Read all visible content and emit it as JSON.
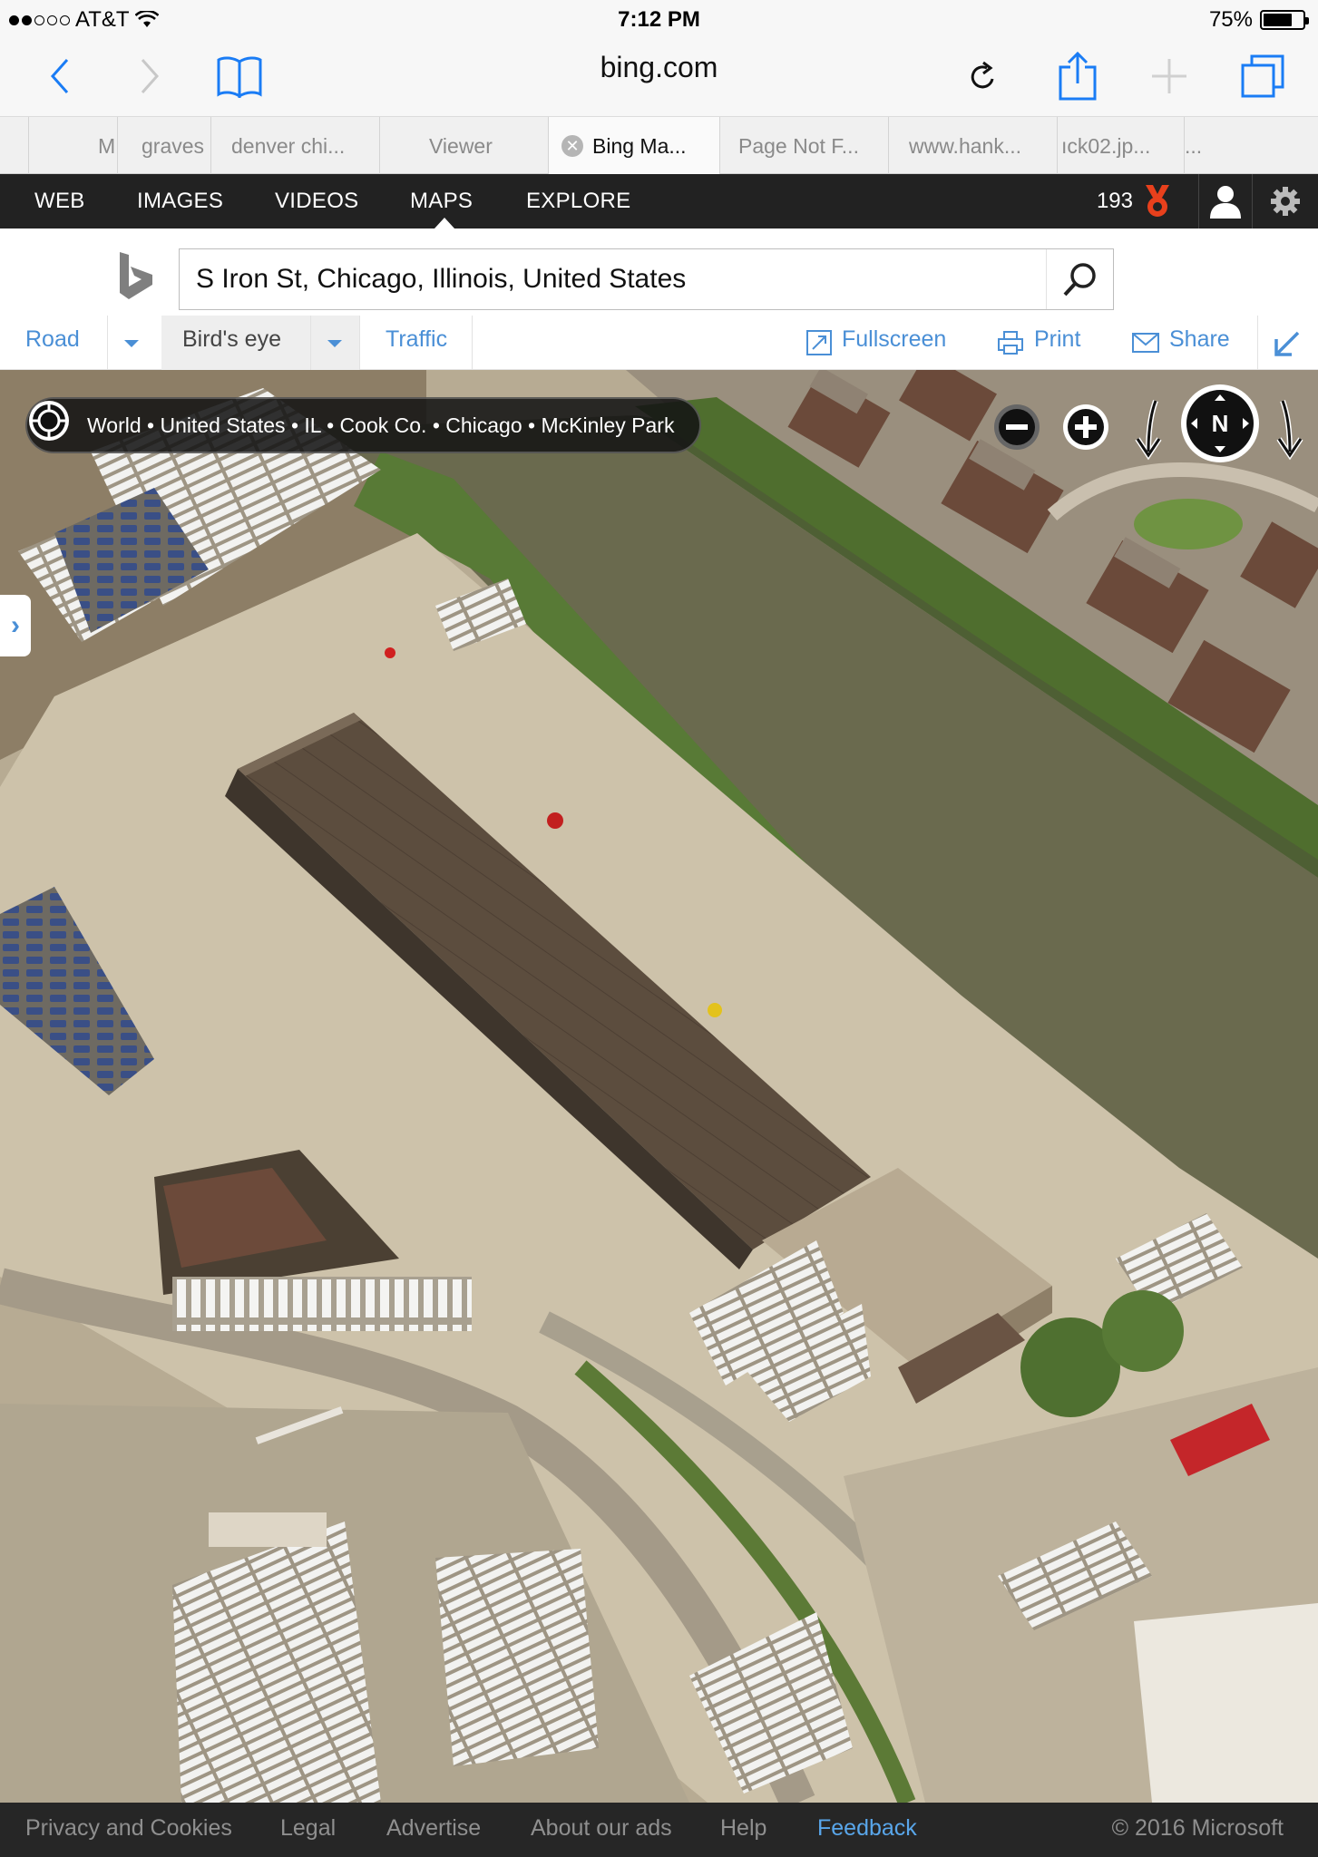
{
  "status": {
    "carrier": "AT&T",
    "time": "7:12 PM",
    "battery_text": "75%",
    "battery_level": 0.75
  },
  "browser": {
    "url": "bing.com",
    "tabs": [
      "M",
      "graves",
      "denver chi...",
      "Viewer",
      "Bing Ma...",
      "Page Not F...",
      "www.hank...",
      "ıck02.jp...",
      "..."
    ]
  },
  "bing_nav": {
    "items": [
      "WEB",
      "IMAGES",
      "VIDEOS",
      "MAPS",
      "EXPLORE"
    ],
    "active": "MAPS",
    "rewards_count": "193"
  },
  "search": {
    "query": "S Iron St, Chicago, Illinois, United States"
  },
  "map_toolbar": {
    "road": "Road",
    "birds_eye": "Bird's eye",
    "traffic": "Traffic",
    "fullscreen": "Fullscreen",
    "print": "Print",
    "share": "Share"
  },
  "map": {
    "breadcrumb": "World • United States • IL • Cook Co. • Chicago • McKinley Park",
    "compass_label": "N",
    "colors": {
      "water": "#6a6a4e",
      "trees": "#587a36",
      "lot": "#cdc2aa",
      "roof": "#5c4d3e"
    }
  },
  "footer": {
    "links": [
      "Privacy and Cookies",
      "Legal",
      "Advertise",
      "About our ads",
      "Help",
      "Feedback"
    ],
    "copyright": "© 2016 Microsoft"
  }
}
